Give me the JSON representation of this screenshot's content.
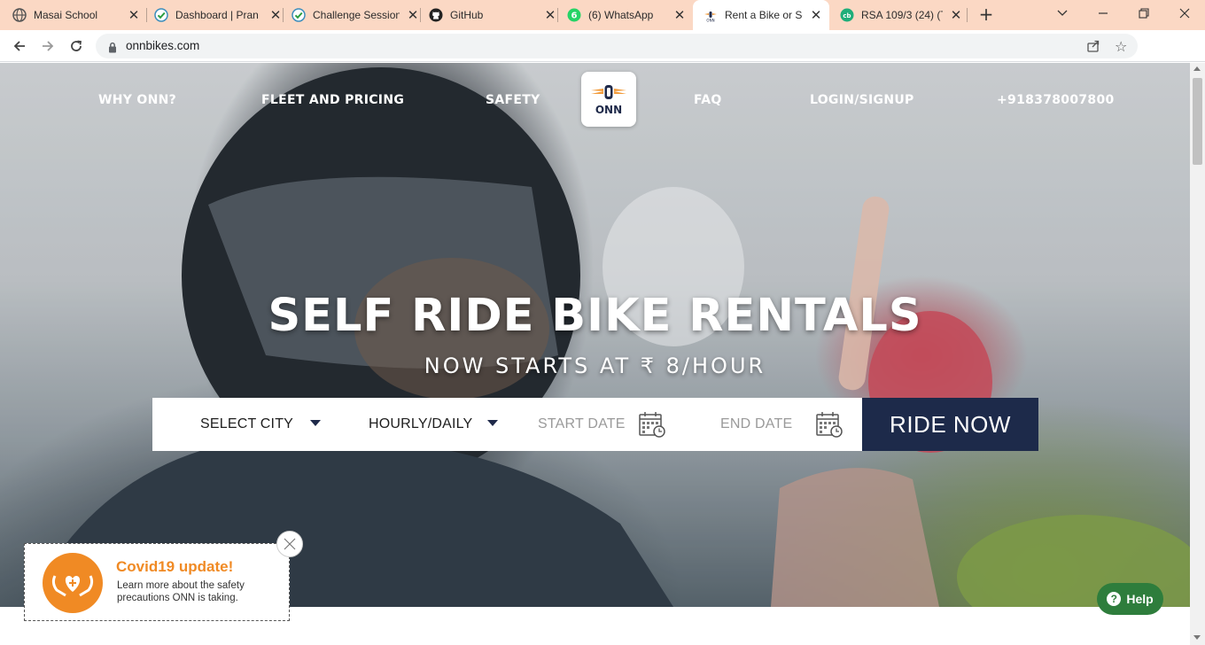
{
  "browser": {
    "tabs": [
      {
        "title": "Masai School",
        "icon": "globe-icon"
      },
      {
        "title": "Dashboard | Pran",
        "icon": "check-circle-icon"
      },
      {
        "title": "Challenge Session",
        "icon": "check-circle-icon"
      },
      {
        "title": "GitHub",
        "icon": "github-icon"
      },
      {
        "title": "(6) WhatsApp",
        "icon": "whatsapp-icon",
        "badge": "6"
      },
      {
        "title": "Rent a Bike or Sc",
        "icon": "onn-favicon",
        "active": true
      },
      {
        "title": "RSA 109/3 (24) (T",
        "icon": "cricbuzz-icon"
      }
    ],
    "url": "onnbikes.com",
    "tab_bar_color": "#fbd8c4"
  },
  "nav": {
    "links": [
      "WHY ONN?",
      "FLEET AND PRICING",
      "SAFETY",
      "FAQ",
      "LOGIN/SIGNUP",
      "+918378007800"
    ],
    "logo_text": "ONN"
  },
  "hero": {
    "headline": "SELF RIDE BIKE RENTALS",
    "subheadline": "NOW STARTS AT ₹ 8/HOUR"
  },
  "booking": {
    "city_label": "SELECT CITY",
    "duration_label": "HOURLY/DAILY",
    "start_date_placeholder": "START DATE",
    "end_date_placeholder": "END DATE",
    "ride_now_label": "RIDE NOW",
    "button_color": "#1d2a4a"
  },
  "covid": {
    "title": "Covid19 update!",
    "description": "Learn more about the safety precautions ONN is taking.",
    "accent_color": "#f08a24"
  },
  "help": {
    "label": "Help",
    "color": "#2e7d3c"
  }
}
